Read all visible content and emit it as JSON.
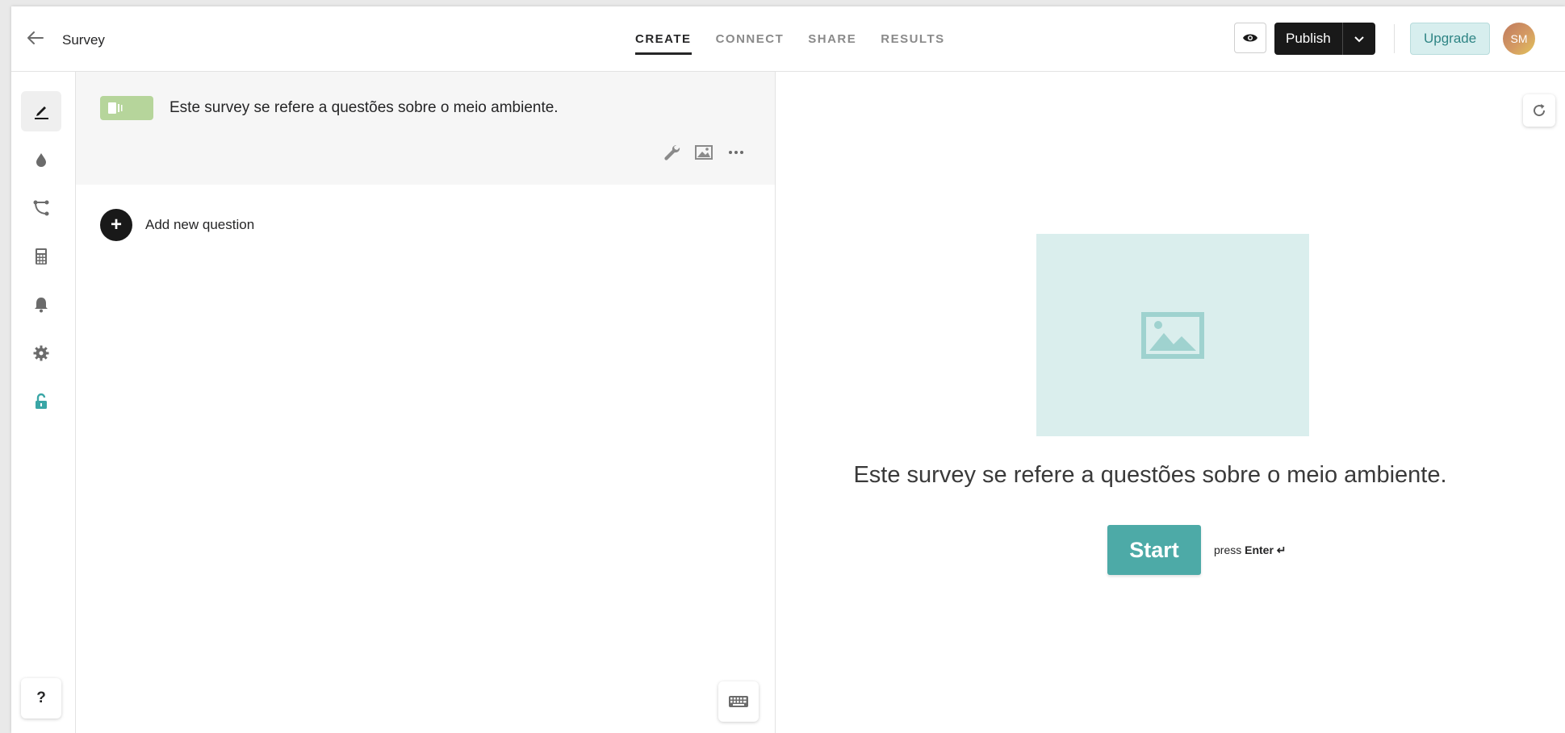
{
  "header": {
    "title": "Survey",
    "tabs": [
      {
        "label": "CREATE",
        "active": true
      },
      {
        "label": "CONNECT",
        "active": false
      },
      {
        "label": "SHARE",
        "active": false
      },
      {
        "label": "RESULTS",
        "active": false
      }
    ],
    "publish_label": "Publish",
    "upgrade_label": "Upgrade",
    "avatar_initials": "SM"
  },
  "sidebar": {
    "items": [
      {
        "icon": "pen-icon",
        "active": true
      },
      {
        "icon": "drop-icon",
        "active": false
      },
      {
        "icon": "logic-flow-icon",
        "active": false
      },
      {
        "icon": "calculator-icon",
        "active": false
      },
      {
        "icon": "bell-icon",
        "active": false
      },
      {
        "icon": "gear-icon",
        "active": false
      },
      {
        "icon": "unlock-icon",
        "active": false,
        "color": "#3aa6a6"
      }
    ],
    "help_label": "?"
  },
  "editor": {
    "welcome_text": "Este survey se refere a questões sobre o meio ambiente.",
    "add_question_label": "Add new question"
  },
  "preview": {
    "welcome_text": "Este survey se refere a questões sobre o meio ambiente.",
    "start_label": "Start",
    "press_label": "press",
    "enter_label": "Enter ↵"
  },
  "colors": {
    "accent": "#4daaa7",
    "badge": "#b6d59b",
    "image_placeholder": "#daeeed",
    "publish_bg": "#191919"
  }
}
